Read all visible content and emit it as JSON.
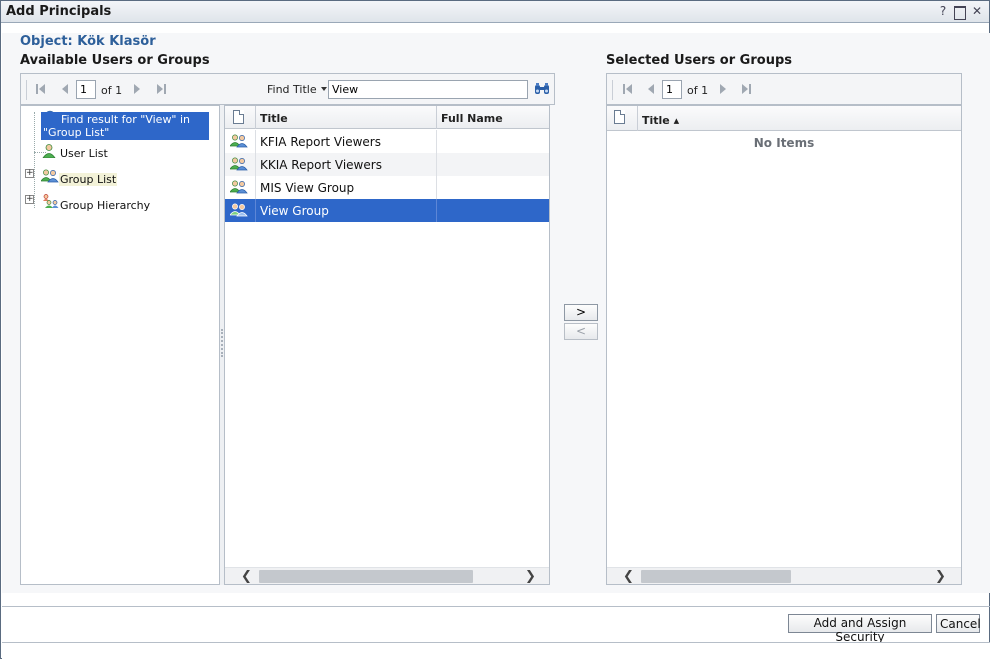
{
  "window": {
    "title": "Add Principals",
    "help_label": "?",
    "close_label": "✕"
  },
  "object": {
    "label": "Object: Kök Klasör"
  },
  "available": {
    "title": "Available Users or Groups",
    "pager": {
      "page": "1",
      "of_label": "of 1"
    },
    "find": {
      "label": "Find Title",
      "value": "View"
    },
    "tree": [
      {
        "label": "Find result for \"View\" in \"Group List\"",
        "selected": true
      },
      {
        "label": "User List"
      },
      {
        "label": "Group List"
      },
      {
        "label": "Group Hierarchy"
      }
    ],
    "grid": {
      "columns": [
        "Title",
        "Full Name"
      ],
      "rows": [
        {
          "title": "KFIA Report Viewers",
          "full_name": ""
        },
        {
          "title": "KKIA Report Viewers",
          "full_name": ""
        },
        {
          "title": "MIS View Group",
          "full_name": ""
        },
        {
          "title": "View Group",
          "full_name": "",
          "selected": true
        }
      ]
    }
  },
  "move": {
    "add_label": ">",
    "remove_label": "<"
  },
  "selected": {
    "title": "Selected Users or Groups",
    "pager": {
      "page": "1",
      "of_label": "of 1"
    },
    "grid": {
      "columns": [
        "Title ▴"
      ],
      "empty_text": "No Items"
    }
  },
  "footer": {
    "assign_label": "Add and Assign Security",
    "cancel_label": "Cancel"
  },
  "colors": {
    "selection": "#2e67c9",
    "accent": "#2d5f9a"
  }
}
